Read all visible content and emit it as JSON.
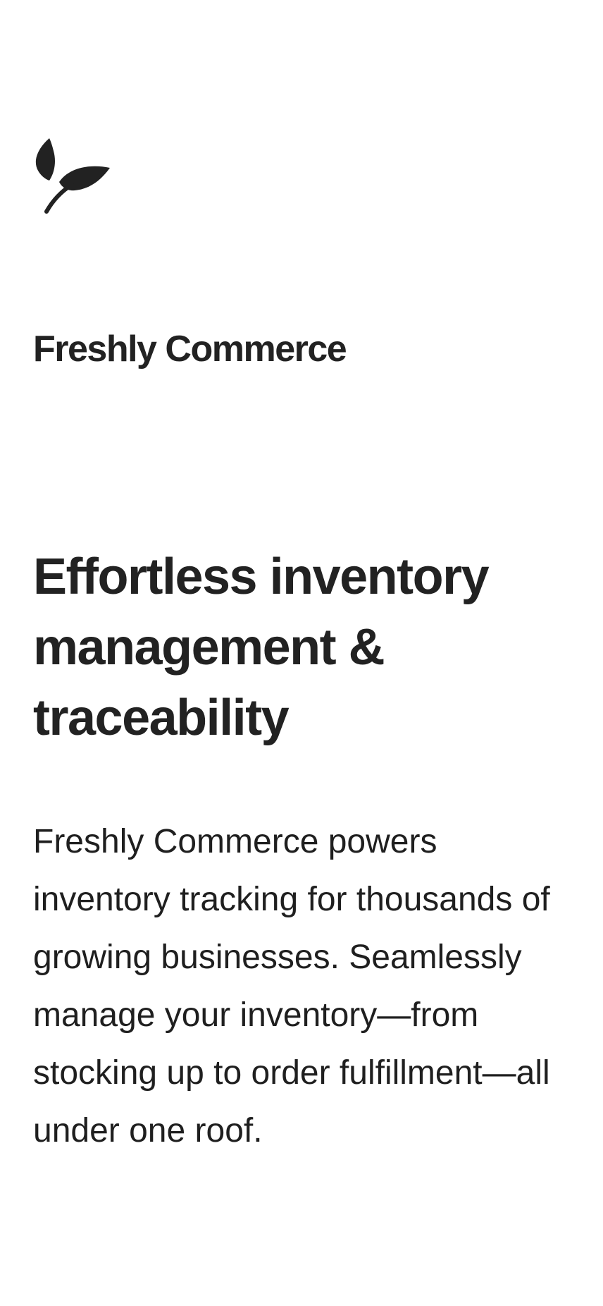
{
  "brand": {
    "logo_icon": "leaf-icon",
    "name": "Freshly Commerce"
  },
  "hero": {
    "headline": "Effortless inventory management & traceability",
    "description": "Freshly Commerce powers inventory tracking for thousands of growing businesses. Seamlessly manage your inventory—from stocking up to order fulfillment—all under one roof."
  },
  "colors": {
    "background": "#ffffff",
    "text": "#222222"
  }
}
